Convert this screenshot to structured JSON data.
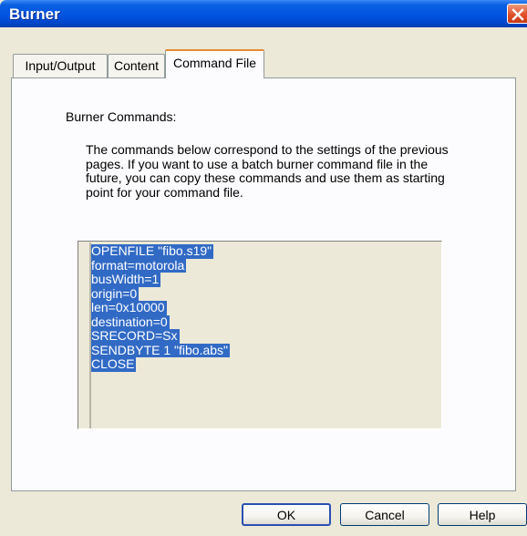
{
  "window": {
    "title": "Burner"
  },
  "tabs": [
    {
      "label": "Input/Output"
    },
    {
      "label": "Content"
    },
    {
      "label": "Command File"
    }
  ],
  "panel": {
    "section_label": "Burner Commands:",
    "description": "The commands below correspond to the settings of the previous pages. If you want to use a batch burner command file in the future, you can copy these commands and use them as starting point for your command file.",
    "commands": [
      "OPENFILE \"fibo.s19\"",
      "format=motorola",
      "busWidth=1",
      "origin=0",
      "len=0x10000",
      "destination=0",
      "SRECORD=Sx",
      "SENDBYTE 1 \"fibo.abs\"",
      "CLOSE"
    ]
  },
  "buttons": {
    "ok": "OK",
    "cancel": "Cancel",
    "help": "Help"
  },
  "colors": {
    "selection": "#316ac5",
    "titlebar": "#0054e3",
    "active_tab_accent": "#e68b2c"
  }
}
